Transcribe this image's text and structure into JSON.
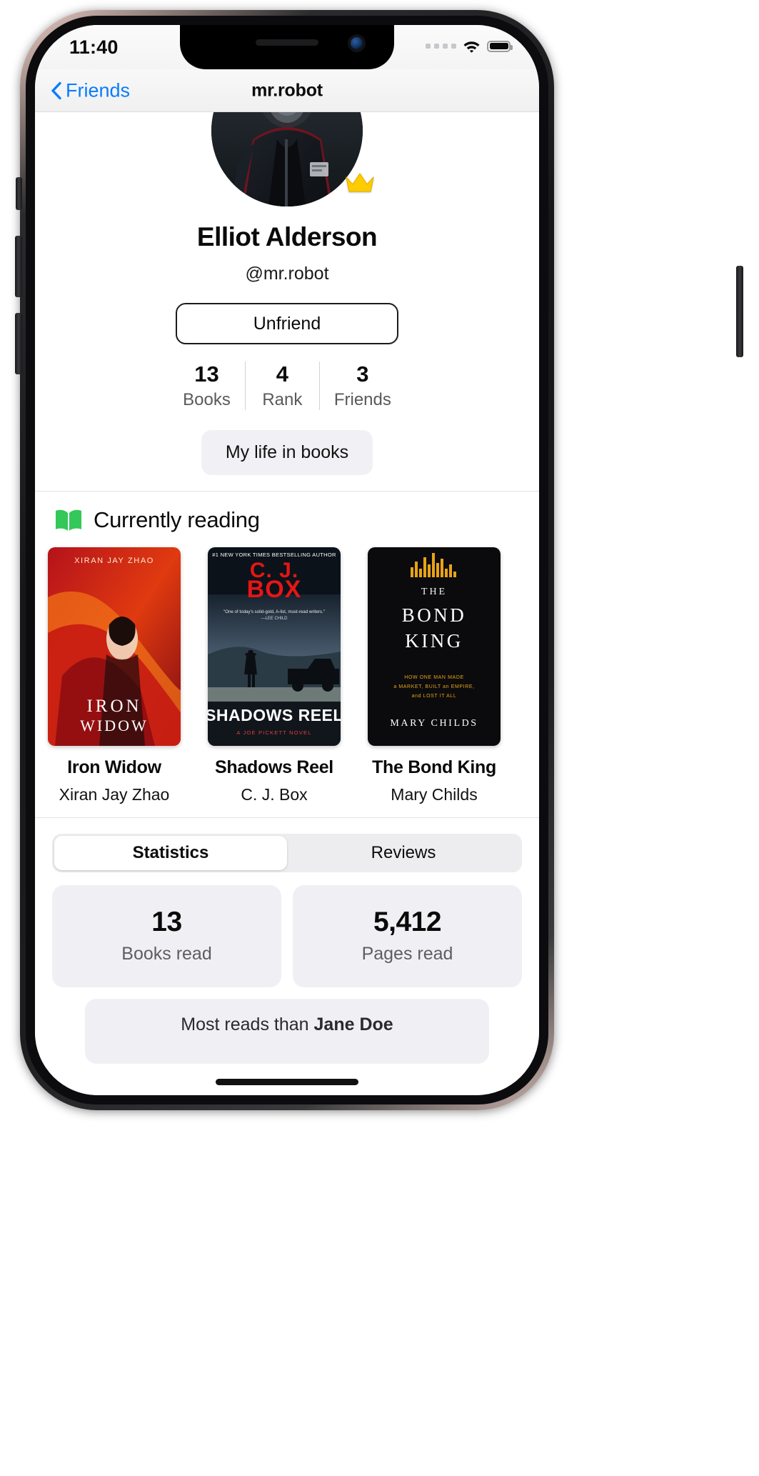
{
  "status_bar": {
    "time": "11:40",
    "signal_icon": "signal-dots-icon",
    "wifi_icon": "wifi-icon",
    "battery_icon": "battery-full-icon"
  },
  "nav_bar": {
    "back_icon": "chevron-left-icon",
    "back_label": "Friends",
    "title": "mr.robot"
  },
  "profile": {
    "avatar_alt": "user-avatar",
    "crown_badge": "crown-icon",
    "display_name": "Elliot Alderson",
    "handle": "@mr.robot",
    "unfriend_label": "Unfriend",
    "stats": [
      {
        "value": "13",
        "label": "Books"
      },
      {
        "value": "4",
        "label": "Rank"
      },
      {
        "value": "3",
        "label": "Friends"
      }
    ],
    "life_in_books_label": "My life in books"
  },
  "currently_reading": {
    "icon": "open-book-icon",
    "title": "Currently reading",
    "books": [
      {
        "title": "Iron Widow",
        "author": "Xiran Jay Zhao",
        "cover_title": "IRON WIDOW",
        "cover_author": "XIRAN JAY ZHAO"
      },
      {
        "title": "Shadows Reel",
        "author": "C. J. Box",
        "cover_title": "SHADOWS REEL",
        "cover_author": "C. J. BOX",
        "cover_blurb": "#1 NEW YORK TIMES BESTSELLING AUTHOR",
        "cover_quote": "\"One of today's solid-gold, A-list, must-read writers.\" —LEE CHILD",
        "cover_series": "A JOE PICKETT NOVEL"
      },
      {
        "title": "The Bond King",
        "author": "Mary Childs",
        "cover_title": "THE BOND KING",
        "cover_author": "MARY CHILDS",
        "cover_sub": "HOW ONE MAN MADE a MARKET, BUILT an EMPIRE, and LOST IT ALL"
      }
    ]
  },
  "bottom": {
    "tabs": [
      {
        "label": "Statistics",
        "selected": true
      },
      {
        "label": "Reviews",
        "selected": false
      }
    ],
    "cards": [
      {
        "number": "13",
        "caption": "Books read"
      },
      {
        "number": "5,412",
        "caption": "Pages read"
      }
    ],
    "wide_card_prefix": "Most reads than ",
    "wide_card_highlight": "Jane Doe",
    "colors": {
      "accent_blue": "#0a7cff",
      "book_green": "#34c759",
      "crown_gold": "#ffcc00",
      "card_gray": "#f0f0f4"
    }
  }
}
